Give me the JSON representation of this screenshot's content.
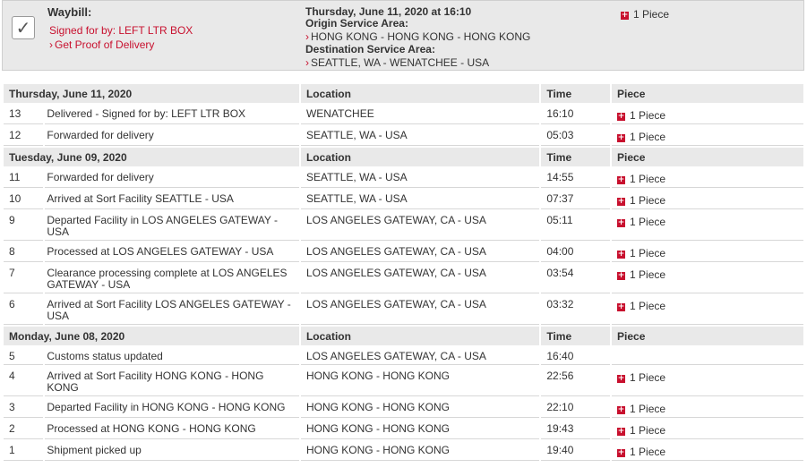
{
  "summary": {
    "waybill_label": "Waybill:",
    "signed_for": "Signed for by: LEFT LTR BOX",
    "proof_link": "Get Proof of Delivery",
    "delivered_datetime": "Thursday, June 11, 2020 at 16:10",
    "origin_label": "Origin Service Area:",
    "origin_value": "HONG KONG - HONG KONG - HONG KONG",
    "destination_label": "Destination Service Area:",
    "destination_value": "SEATTLE, WA - WENATCHEE - USA",
    "piece_count": "1 Piece"
  },
  "columns": {
    "location": "Location",
    "time": "Time",
    "piece": "Piece"
  },
  "groups": [
    {
      "date": "Thursday, June 11, 2020",
      "events": [
        {
          "num": "13",
          "desc": "Delivered - Signed for by: LEFT LTR BOX",
          "location": "WENATCHEE",
          "time": "16:10",
          "piece": "1 Piece"
        },
        {
          "num": "12",
          "desc": "Forwarded for delivery",
          "location": "SEATTLE, WA - USA",
          "time": "05:03",
          "piece": "1 Piece"
        }
      ]
    },
    {
      "date": "Tuesday, June 09, 2020",
      "events": [
        {
          "num": "11",
          "desc": "Forwarded for delivery",
          "location": "SEATTLE, WA - USA",
          "time": "14:55",
          "piece": "1 Piece"
        },
        {
          "num": "10",
          "desc": "Arrived at Sort Facility SEATTLE - USA",
          "location": "SEATTLE, WA - USA",
          "time": "07:37",
          "piece": "1 Piece"
        },
        {
          "num": "9",
          "desc": "Departed Facility in LOS ANGELES GATEWAY - USA",
          "location": "LOS ANGELES GATEWAY, CA - USA",
          "time": "05:11",
          "piece": "1 Piece"
        },
        {
          "num": "8",
          "desc": "Processed at LOS ANGELES GATEWAY - USA",
          "location": "LOS ANGELES GATEWAY, CA - USA",
          "time": "04:00",
          "piece": "1 Piece"
        },
        {
          "num": "7",
          "desc": "Clearance processing complete at LOS ANGELES GATEWAY - USA",
          "location": "LOS ANGELES GATEWAY, CA - USA",
          "time": "03:54",
          "piece": "1 Piece"
        },
        {
          "num": "6",
          "desc": "Arrived at Sort Facility LOS ANGELES GATEWAY - USA",
          "location": "LOS ANGELES GATEWAY, CA - USA",
          "time": "03:32",
          "piece": "1 Piece"
        }
      ]
    },
    {
      "date": "Monday, June 08, 2020",
      "events": [
        {
          "num": "5",
          "desc": "Customs status updated",
          "location": "LOS ANGELES GATEWAY, CA - USA",
          "time": "16:40",
          "piece": ""
        },
        {
          "num": "4",
          "desc": "Arrived at Sort Facility HONG KONG - HONG KONG",
          "location": "HONG KONG - HONG KONG",
          "time": "22:56",
          "piece": "1 Piece"
        },
        {
          "num": "3",
          "desc": "Departed Facility in HONG KONG - HONG KONG",
          "location": "HONG KONG - HONG KONG",
          "time": "22:10",
          "piece": "1 Piece"
        },
        {
          "num": "2",
          "desc": "Processed at HONG KONG - HONG KONG",
          "location": "HONG KONG - HONG KONG",
          "time": "19:43",
          "piece": "1 Piece"
        },
        {
          "num": "1",
          "desc": "Shipment picked up",
          "location": "HONG KONG - HONG KONG",
          "time": "19:40",
          "piece": "1 Piece"
        }
      ]
    }
  ],
  "icons": {
    "check": "checkbox-checked-icon",
    "chevron": "chevron-right-icon",
    "expand": "plus-expand-icon"
  },
  "colors": {
    "accent": "#c8102e",
    "header_bg": "#e9e9e9"
  }
}
